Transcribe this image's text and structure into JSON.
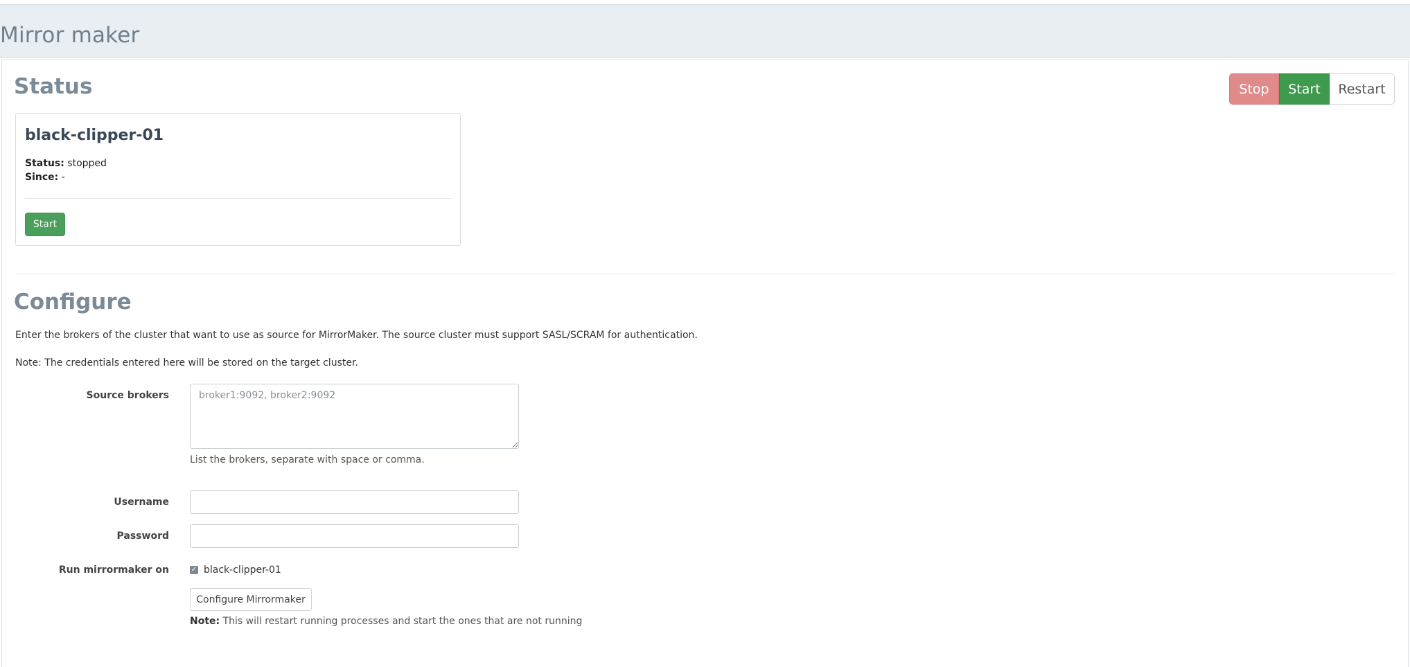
{
  "header": {
    "title": "Mirror maker"
  },
  "status": {
    "title": "Status",
    "actions": {
      "stop": "Stop",
      "start": "Start",
      "restart": "Restart"
    },
    "node": {
      "name": "black-clipper-01",
      "status_label": "Status:",
      "status_value": "stopped",
      "since_label": "Since:",
      "since_value": "-",
      "start_button": "Start"
    }
  },
  "configure": {
    "title": "Configure",
    "description": "Enter the brokers of the cluster that want to use as source for MirrorMaker. The source cluster must support SASL/SCRAM for authentication.",
    "note": "Note: The credentials entered here will be stored on the target cluster.",
    "source_brokers": {
      "label": "Source brokers",
      "placeholder": "broker1:9092, broker2:9092",
      "value": "",
      "hint": "List the brokers, separate with space or comma."
    },
    "username": {
      "label": "Username",
      "value": ""
    },
    "password": {
      "label": "Password",
      "value": ""
    },
    "run_on": {
      "label": "Run mirrormaker on",
      "node": "black-clipper-01",
      "checked": true
    },
    "submit_button": "Configure Mirrormaker",
    "restart_note_label": "Note:",
    "restart_note_text": " This will restart running processes and start the ones that are not running"
  },
  "colors": {
    "header_bg": "#e8eef2",
    "stop": "#e08a8a",
    "start": "#3e9a4d",
    "title_gray": "#7b8a97"
  }
}
